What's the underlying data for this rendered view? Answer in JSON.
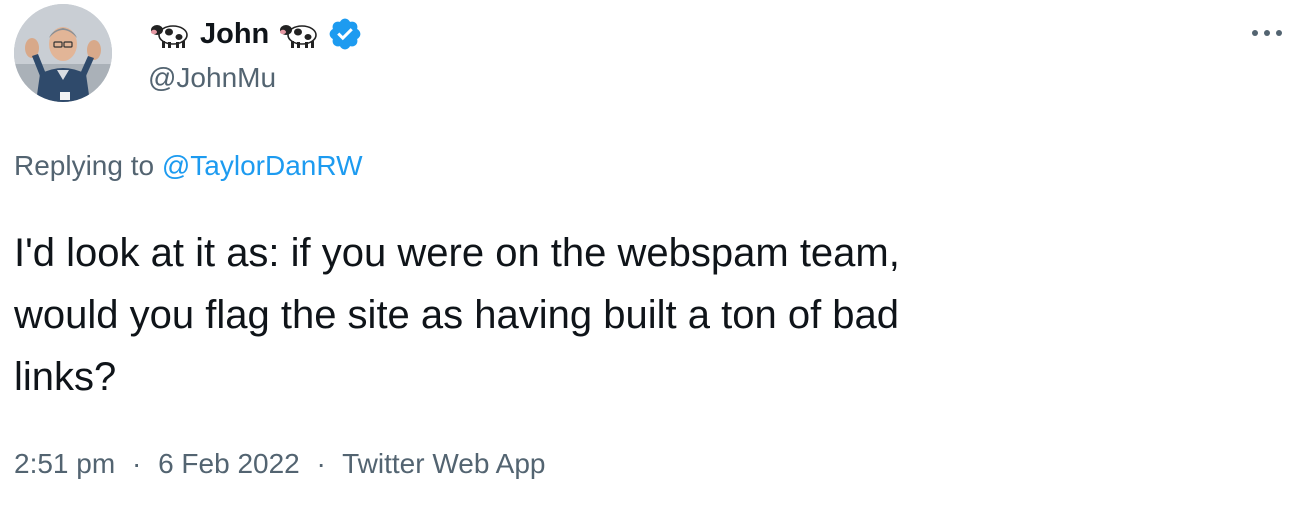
{
  "author": {
    "display_name": "John",
    "handle": "@JohnMu",
    "emoji_icon": "cow-icon",
    "verified_icon": "verified-badge-icon",
    "verified_color": "#1d9bf0"
  },
  "reply": {
    "prefix": "Replying to",
    "mention": "@TaylorDanRW",
    "mention_color": "#1d9bf0"
  },
  "tweet": {
    "lines": [
      "I'd look at it as: if you were on the webspam team,",
      "would you flag the site as having built a ton of bad",
      "links?"
    ]
  },
  "meta": {
    "time": "2:51 pm",
    "date": "6 Feb 2022",
    "source": "Twitter Web App",
    "separator": "·"
  },
  "more_icon": "more-options-icon"
}
